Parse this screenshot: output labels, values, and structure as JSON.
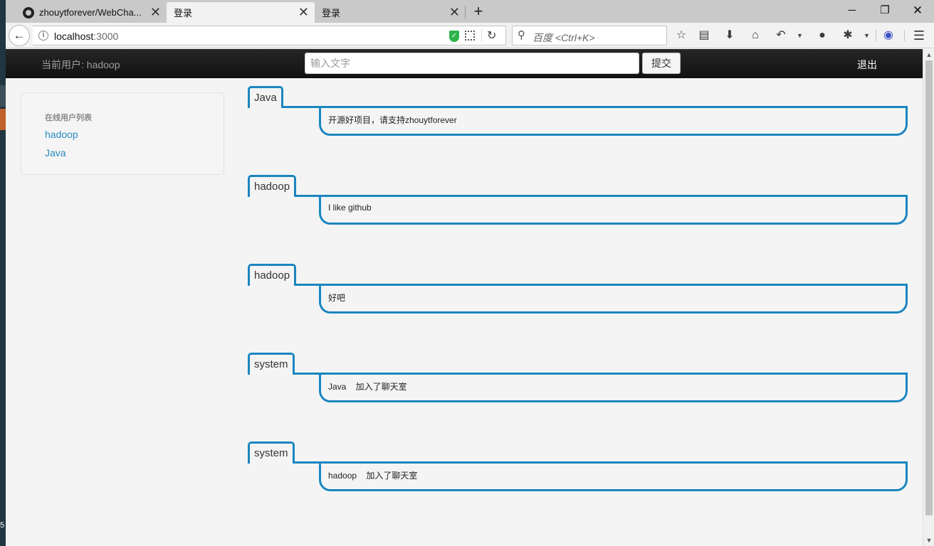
{
  "browser": {
    "tabs": [
      {
        "title": "zhouytforever/WebCha..."
      },
      {
        "title": "登录"
      },
      {
        "title": "登录"
      }
    ],
    "url_host": "localhost",
    "url_port": ":3000",
    "search_placeholder": "百度 <Ctrl+K>"
  },
  "header": {
    "current_user": "当前用户: hadoop",
    "input_placeholder": "输入文字",
    "submit_label": "提交",
    "logout_label": "退出"
  },
  "sidebar": {
    "title": "在线用户列表",
    "users": [
      "hadoop",
      "Java"
    ]
  },
  "messages": [
    {
      "name": "Java",
      "text": "开源好项目，请支持zhouytforever"
    },
    {
      "name": "hadoop",
      "text": "I like github"
    },
    {
      "name": "hadoop",
      "text": "好吧"
    },
    {
      "name": "system",
      "text": "Java    加入了聊天室"
    },
    {
      "name": "system",
      "text": "hadoop    加入了聊天室"
    }
  ],
  "colors": {
    "accent": "#1a86c0",
    "link": "#2a8abf",
    "topbar": "#1a1a1a"
  },
  "icons": [
    "github-icon",
    "close-icon",
    "plus-icon",
    "back-icon",
    "info-icon",
    "shield-icon",
    "qr-icon",
    "reload-icon",
    "search-icon",
    "star-icon",
    "reader-icon",
    "download-icon",
    "home-icon",
    "undo-icon",
    "chat-icon",
    "extension-icon",
    "globe-icon",
    "menu-icon"
  ]
}
